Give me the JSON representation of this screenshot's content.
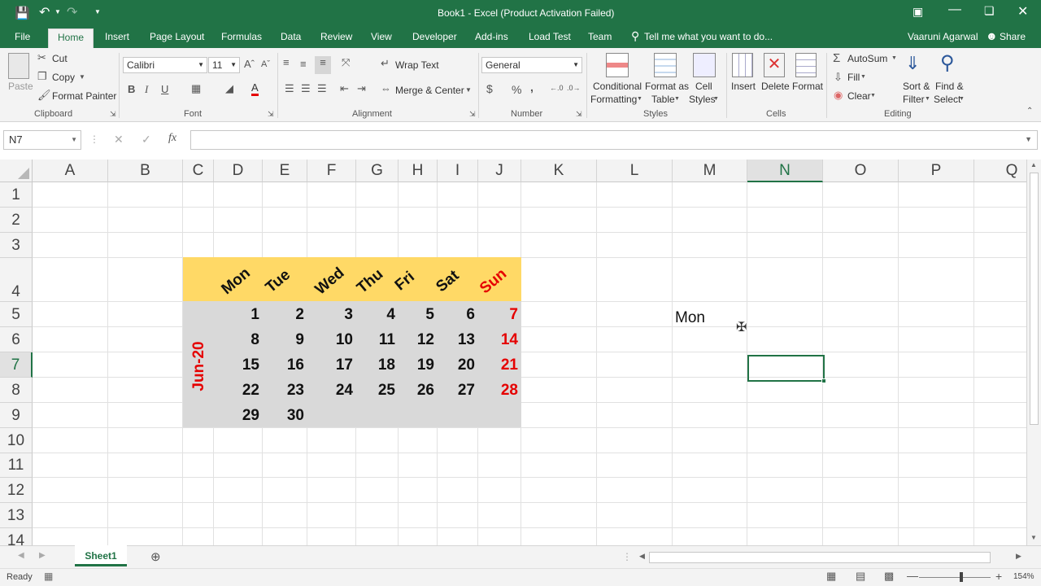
{
  "window": {
    "title": "Book1 - Excel (Product Activation Failed)",
    "user": "Vaaruni Agarwal",
    "share_label": "Share"
  },
  "quick_access": {
    "save_icon": "save-icon",
    "undo_icon": "undo-icon",
    "redo_icon": "redo-icon"
  },
  "ribbon_tabs": [
    "File",
    "Home",
    "Insert",
    "Page Layout",
    "Formulas",
    "Data",
    "Review",
    "View",
    "Developer",
    "Add-ins",
    "Load Test",
    "Team"
  ],
  "tell_me": "Tell me what you want to do...",
  "clipboard": {
    "paste": "Paste",
    "cut": "Cut",
    "copy": "Copy",
    "format_painter": "Format Painter",
    "group": "Clipboard"
  },
  "font": {
    "name": "Calibri",
    "size": "11",
    "group": "Font"
  },
  "alignment": {
    "wrap_text": "Wrap Text",
    "merge_center": "Merge & Center",
    "group": "Alignment"
  },
  "number": {
    "format": "General",
    "group": "Number",
    "currency": "$",
    "percent": "%",
    "comma": ","
  },
  "styles": {
    "conditional": "Conditional",
    "formatting": "Formatting",
    "format_as": "Format as",
    "table": "Table",
    "cell": "Cell",
    "cell_styles": "Styles",
    "group": "Styles"
  },
  "cells": {
    "insert": "Insert",
    "delete": "Delete",
    "format": "Format",
    "group": "Cells"
  },
  "editing": {
    "autosum": "AutoSum",
    "fill": "Fill",
    "clear": "Clear",
    "sort": "Sort &",
    "filter": "Filter",
    "find": "Find &",
    "select": "Select",
    "group": "Editing"
  },
  "formula_bar": {
    "name_box": "N7",
    "formula": ""
  },
  "columns": [
    "A",
    "B",
    "C",
    "D",
    "E",
    "F",
    "G",
    "H",
    "I",
    "J",
    "K",
    "L",
    "M",
    "N",
    "O",
    "P",
    "Q"
  ],
  "rows": [
    "1",
    "2",
    "3",
    "4",
    "5",
    "6",
    "7",
    "8",
    "9",
    "10",
    "11",
    "12",
    "13",
    "14"
  ],
  "calendar": {
    "month_label": "Jun-20",
    "days": [
      "Mon",
      "Tue",
      "Wed",
      "Thu",
      "Fri",
      "Sat",
      "Sun"
    ],
    "weeks": [
      [
        "",
        "1",
        "2",
        "3",
        "4",
        "5",
        "6",
        "7"
      ],
      [
        "",
        "8",
        "9",
        "10",
        "11",
        "12",
        "13",
        "14"
      ],
      [
        "",
        "15",
        "16",
        "17",
        "18",
        "19",
        "20",
        "21"
      ],
      [
        "",
        "22",
        "23",
        "24",
        "25",
        "26",
        "27",
        "28"
      ],
      [
        "",
        "29",
        "30",
        "",
        "",
        "",
        "",
        ""
      ]
    ],
    "header_color": "#ffd966",
    "body_color": "#d9d9d9",
    "accent_color": "#e50000"
  },
  "cell_m5": "Mon",
  "sheet": {
    "name": "Sheet1"
  },
  "status": {
    "ready": "Ready",
    "zoom": "154%"
  }
}
